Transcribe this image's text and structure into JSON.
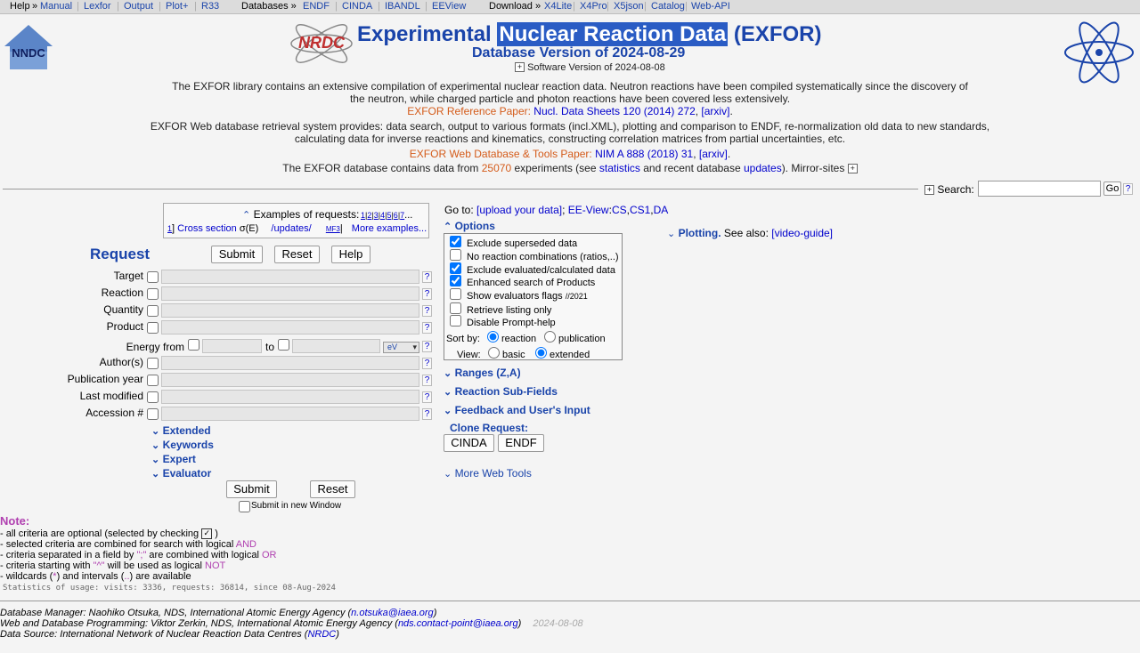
{
  "topbar": {
    "help": "Help",
    "help_arrow": "»",
    "links1": [
      "Manual",
      "Lexfor",
      "Output",
      "Plot+",
      "R33"
    ],
    "databases": "Databases »",
    "links2": [
      "ENDF",
      "CINDA",
      "IBANDL",
      "EEView"
    ],
    "download": "Download »",
    "links3": [
      "X4Lite",
      "X4Pro",
      "X5json",
      "Catalog",
      "Web-API"
    ]
  },
  "header": {
    "nndc_text": "NNDC",
    "nrdc_text": "NRDC",
    "title_pre": "Experimental ",
    "title_hl": "Nuclear Reaction Data",
    "title_post": " (EXFOR)",
    "version": "Database Version of 2024-08-29",
    "software_version": "Software Version of 2024-08-08"
  },
  "intro": {
    "p1_line1": "The EXFOR library contains an extensive compilation of experimental nuclear reaction data. Neutron reactions have been compiled systematically since the discovery of",
    "p1_line2": "the neutron, while charged particle and photon reactions have been covered less extensively.",
    "ref_label": "EXFOR Reference Paper:",
    "ref_link": "Nucl. Data Sheets 120 (2014) 272",
    "ref_arxiv": "[arxiv]",
    "p2_line1": "EXFOR Web database retrieval system provides: data search, output to various formats (incl.XML), plotting and comparison to ENDF, re-normalization old data to new standards,",
    "p2_line2": "calculating data for inverse reactions and kinematics, constructing correlation matrices from partial uncertainties, etc.",
    "tools_label": "EXFOR Web Database & Tools Paper:",
    "tools_link": "NIM A 888 (2018) 31",
    "tools_arxiv": "[arxiv]",
    "contains_pre": "The EXFOR database contains data from",
    "count": "25070",
    "contains_mid": "experiments (see",
    "statistics": "statistics",
    "contains_and": "and recent database",
    "updates": "updates",
    "contains_post": ").  Mirror-sites"
  },
  "search": {
    "label": "Search:",
    "value": "",
    "go": "Go",
    "help": "?"
  },
  "examples": {
    "label": "Examples of requests:",
    "nums": [
      "1",
      "2",
      "3",
      "4",
      "5",
      "6",
      "7"
    ],
    "more_dots": "...",
    "row_num": "1",
    "cross_section": "Cross section",
    "sigma": "σ(E)",
    "updates": "/updates/",
    "mf3": "MF3",
    "more": "More examples..."
  },
  "request": {
    "title": "Request",
    "submit": "Submit",
    "reset": "Reset",
    "help": "Help",
    "fields": [
      "Target",
      "Reaction",
      "Quantity",
      "Product"
    ],
    "energy_from": "Energy from",
    "energy_to": "to",
    "energy_unit": "eV",
    "fields2": [
      "Author(s)",
      "Publication year",
      "Last modified",
      "Accession #"
    ],
    "q": "?",
    "sections": [
      "Extended",
      "Keywords",
      "Expert",
      "Evaluator"
    ],
    "submit2": "Submit",
    "reset2": "Reset",
    "new_window": "Submit in new Window"
  },
  "goto": {
    "label": "Go to:",
    "upload": "[upload your data]",
    "semi": ";",
    "eeview": "EE-View",
    "colon": ":",
    "cs": "CS",
    "cs1": "CS1",
    "da": "DA"
  },
  "options": {
    "title": "Options",
    "items": [
      {
        "label": "Exclude superseded data",
        "checked": true
      },
      {
        "label": "No reaction combinations (ratios,..)",
        "checked": false
      },
      {
        "label": "Exclude evaluated/calculated data",
        "checked": true
      },
      {
        "label": "Enhanced search of Products",
        "checked": true
      },
      {
        "label": "Show evaluators flags",
        "checked": false,
        "note": "//2021"
      },
      {
        "label": "Retrieve listing only",
        "checked": false
      },
      {
        "label": "Disable Prompt-help",
        "checked": false
      }
    ],
    "sortby": "Sort by:",
    "sort_reaction": "reaction",
    "sort_publication": "publication",
    "view": "View:",
    "view_basic": "basic",
    "view_extended": "extended"
  },
  "mid_sections": {
    "ranges": "Ranges (Z,A)",
    "subfields": "Reaction Sub-Fields",
    "feedback": "Feedback and User's Input",
    "clone": "Clone Request:",
    "cinda": "CINDA",
    "endf": "ENDF",
    "more_tools": "More Web Tools"
  },
  "plotting": {
    "label": "Plotting.",
    "see_also": "See also:",
    "video": "[video-guide]"
  },
  "note": {
    "title": "Note:",
    "l1_pre": "- all criteria are optional (selected by checking",
    "l1_post": ")",
    "l2_pre": "- selected criteria are combined for search with logical",
    "l2_and": "AND",
    "l3_pre": "- criteria separated in a field by",
    "l3_sym": "\";\"",
    "l3_mid": "are combined with logical",
    "l3_or": "OR",
    "l4_pre": "- criteria starting with",
    "l4_sym": "\"^\"",
    "l4_mid": "will be used as logical",
    "l4_not": "NOT",
    "l5_pre": "- wildcards (",
    "l5_star": "*",
    "l5_mid": ") and intervals (",
    "l5_dots": "..",
    "l5_post": ") are available",
    "stats": "Statistics of usage: visits: 3336, requests: 36814, since 08-Aug-2024"
  },
  "footer": {
    "l1_pre": "Database Manager: Naohiko Otsuka, NDS, International Atomic Energy Agency (",
    "l1_link": "n.otsuka@iaea.org",
    "l1_post": ")",
    "l2_pre": "Web and Database Programming: Viktor Zerkin, NDS, International Atomic Energy Agency (",
    "l2_link": "nds.contact-point@iaea.org",
    "l2_post": ")",
    "l2_date": "2024-08-08",
    "l3_pre": "Data Source: International Network of Nuclear Reaction Data Centres (",
    "l3_link": "NRDC",
    "l3_post": ")"
  }
}
